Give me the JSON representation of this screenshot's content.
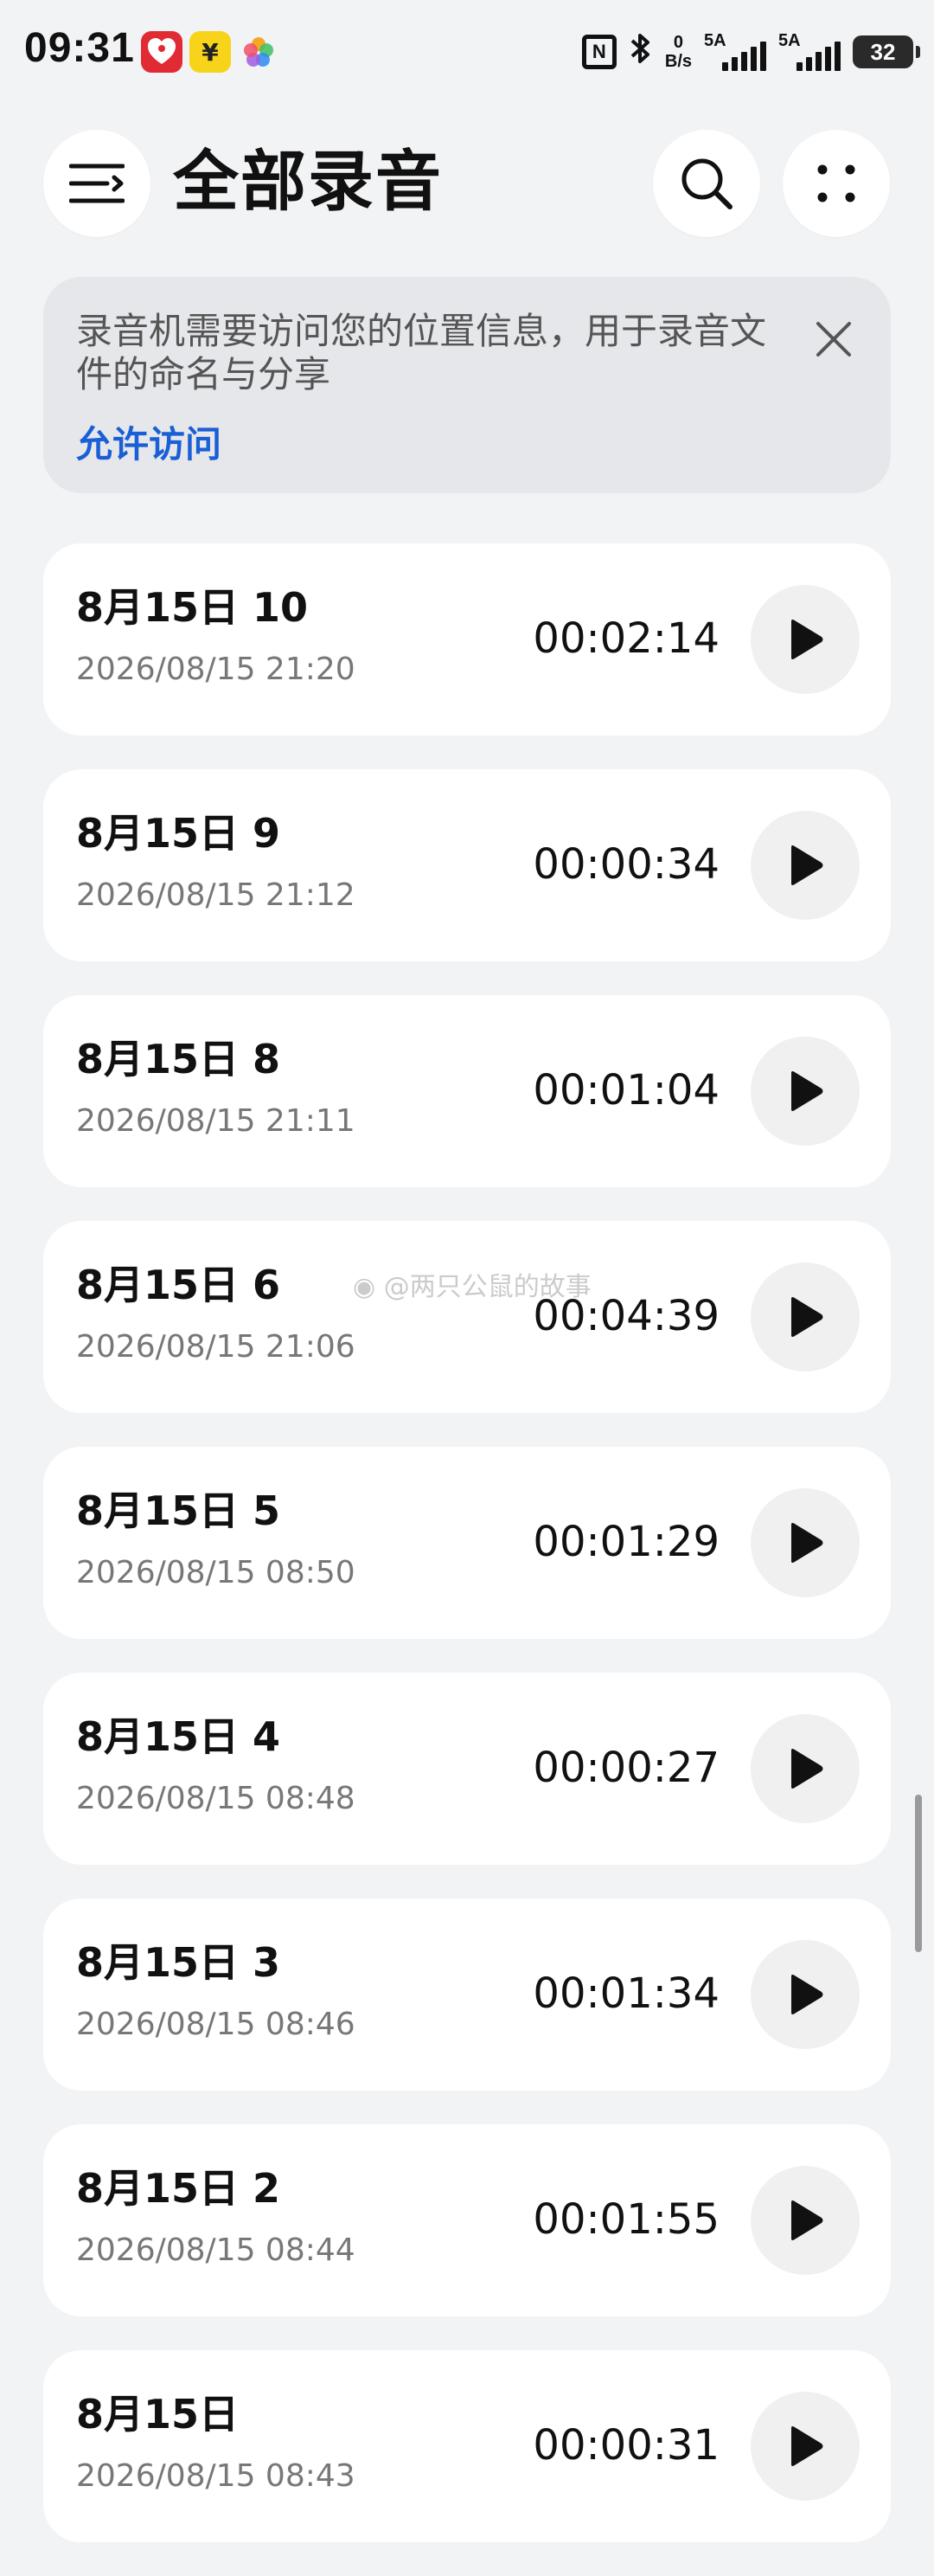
{
  "status_bar": {
    "time": "09:31",
    "app_icons": [
      "red-app-icon",
      "yuan-app-icon",
      "flower-app-icon"
    ],
    "yuan_symbol": "¥",
    "nfc": "N",
    "net_speed_value": "0",
    "net_speed_unit": "B/s",
    "signal_1_label": "5A",
    "signal_2_label": "5A",
    "battery": "32"
  },
  "header": {
    "title": "全部录音"
  },
  "permission_banner": {
    "message": "录音机需要访问您的位置信息，用于录音文件的命名与分享",
    "action_label": "允许访问"
  },
  "recordings": [
    {
      "title": "8月15日 10",
      "datetime": "2026/08/15 21:20",
      "duration": "00:02:14"
    },
    {
      "title": "8月15日 9",
      "datetime": "2026/08/15 21:12",
      "duration": "00:00:34"
    },
    {
      "title": "8月15日 8",
      "datetime": "2026/08/15 21:11",
      "duration": "00:01:04"
    },
    {
      "title": "8月15日 6",
      "datetime": "2026/08/15 21:06",
      "duration": "00:04:39"
    },
    {
      "title": "8月15日 5",
      "datetime": "2026/08/15 08:50",
      "duration": "00:01:29"
    },
    {
      "title": "8月15日 4",
      "datetime": "2026/08/15 08:48",
      "duration": "00:00:27"
    },
    {
      "title": "8月15日 3",
      "datetime": "2026/08/15 08:46",
      "duration": "00:01:34"
    },
    {
      "title": "8月15日 2",
      "datetime": "2026/08/15 08:44",
      "duration": "00:01:55"
    },
    {
      "title": "8月15日",
      "datetime": "2026/08/15 08:43",
      "duration": "00:00:31"
    }
  ],
  "watermark": "@两只公鼠的故事",
  "colors": {
    "background": "#f2f3f5",
    "card": "#ffffff",
    "accent_link": "#1a5fd6",
    "banner": "#e6e7ea"
  }
}
